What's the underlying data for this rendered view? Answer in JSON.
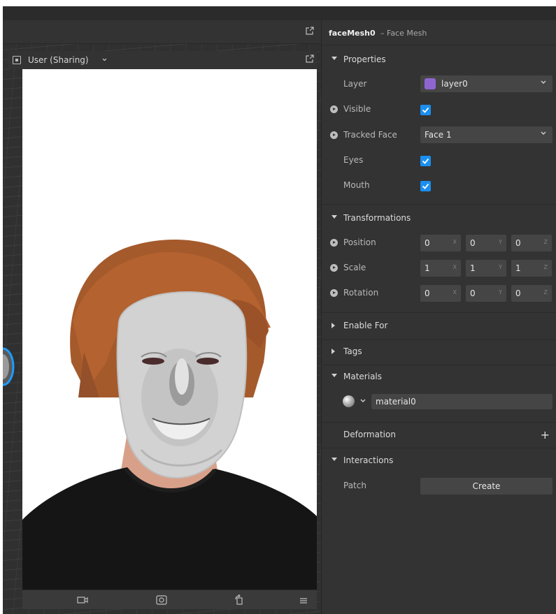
{
  "viewport": {
    "simulator_label": "User (Sharing)"
  },
  "inspector": {
    "object_name": "faceMesh0",
    "object_type": "– Face Mesh",
    "sections": {
      "properties": "Properties",
      "transformations": "Transformations",
      "enable_for": "Enable For",
      "tags": "Tags",
      "materials": "Materials",
      "deformation": "Deformation",
      "interactions": "Interactions"
    },
    "properties": {
      "layer_label": "Layer",
      "layer_value": "layer0",
      "layer_color": "#8f66cf",
      "visible_label": "Visible",
      "visible_checked": true,
      "tracked_face_label": "Tracked Face",
      "tracked_face_value": "Face 1",
      "eyes_label": "Eyes",
      "eyes_checked": true,
      "mouth_label": "Mouth",
      "mouth_checked": true
    },
    "transformations": {
      "position_label": "Position",
      "position": [
        "0",
        "0",
        "0"
      ],
      "scale_label": "Scale",
      "scale": [
        "1",
        "1",
        "1"
      ],
      "rotation_label": "Rotation",
      "rotation": [
        "0",
        "0",
        "0"
      ],
      "axes": [
        "X",
        "Y",
        "Z"
      ]
    },
    "materials": {
      "value": "material0"
    },
    "deformation": {
      "add_symbol": "+"
    },
    "interactions": {
      "patch_label": "Patch",
      "create_label": "Create"
    }
  },
  "colors": {
    "accent": "#1a8ff0",
    "panel": "#333333",
    "field": "#454545"
  }
}
